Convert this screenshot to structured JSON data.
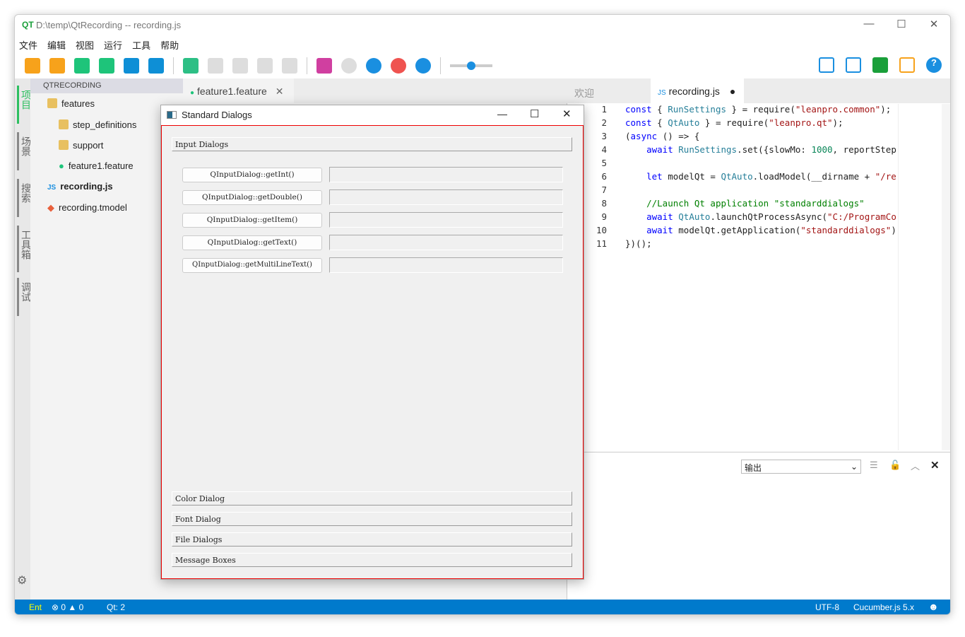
{
  "window": {
    "title": "D:\\temp\\QtRecording -- recording.js",
    "minimize": "—",
    "maximize": "☐",
    "close": "✕"
  },
  "menu": [
    "文件",
    "编辑",
    "视图",
    "运行",
    "工具",
    "帮助"
  ],
  "activity": [
    "项目",
    "场景",
    "搜索",
    "工具箱",
    "调试"
  ],
  "sidebar": {
    "header": "QTRECORDING",
    "items": [
      {
        "label": "features"
      },
      {
        "label": "step_definitions"
      },
      {
        "label": "support"
      },
      {
        "label": "feature1.feature"
      },
      {
        "label": "recording.js"
      },
      {
        "label": "recording.tmodel"
      }
    ]
  },
  "left_tabs": [
    {
      "label": "feature1.feature",
      "close": "✕"
    }
  ],
  "right_tabs": [
    {
      "label": "欢迎"
    },
    {
      "label": "recording.js",
      "badge": "JS",
      "modified": "●"
    }
  ],
  "code": {
    "line_numbers": [
      "1",
      "2",
      "3",
      "4",
      "5",
      "6",
      "7",
      "8",
      "9",
      "10",
      "11"
    ]
  },
  "output": {
    "select": "输出"
  },
  "status": {
    "mode": "Ent",
    "errors": "0",
    "warnings": "0",
    "qt": "Qt: 2",
    "encoding": "UTF-8",
    "framework": "Cucumber.js 5.x"
  },
  "dialog": {
    "title": "Standard Dialogs",
    "group": "Input Dialogs",
    "buttons": [
      "QInputDialog::getInt()",
      "QInputDialog::getDouble()",
      "QInputDialog::getItem()",
      "QInputDialog::getText()",
      "QInputDialog::getMultiLineText()"
    ],
    "sections": [
      "Color Dialog",
      "Font Dialog",
      "File Dialogs",
      "Message Boxes"
    ]
  },
  "colors": {
    "accent": "#007acc",
    "dialog_border": "#e00000"
  }
}
